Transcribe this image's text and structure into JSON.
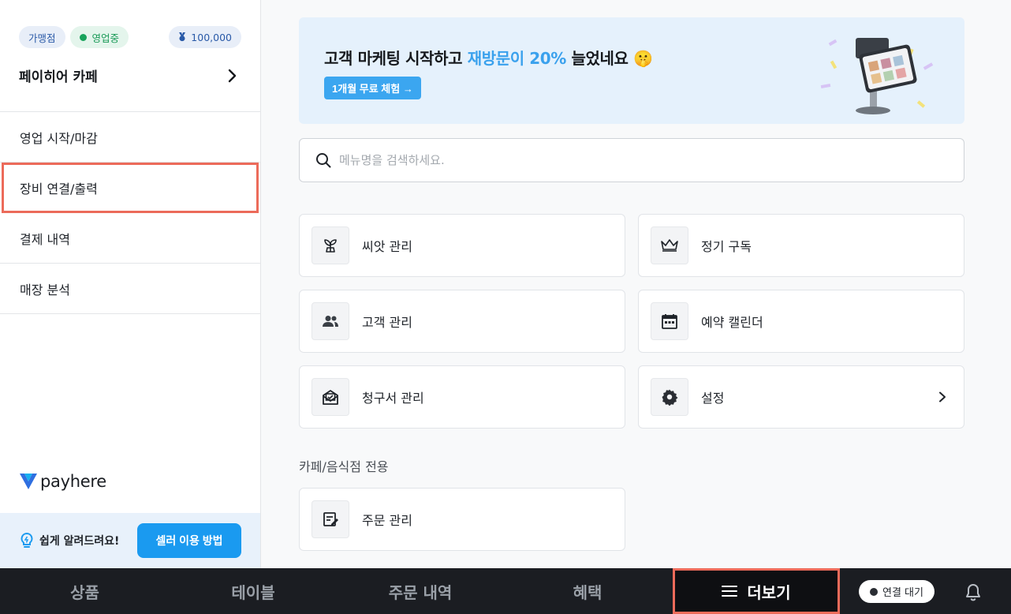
{
  "sidebar": {
    "badges": {
      "franchise": "가맹점",
      "status": "영업중",
      "points": "100,000"
    },
    "store_name": "페이히어 카페",
    "menu": [
      {
        "label": "영업 시작/마감"
      },
      {
        "label": "장비 연결/출력"
      },
      {
        "label": "결제 내역"
      },
      {
        "label": "매장 분석"
      }
    ],
    "logo_text": "payhere",
    "help": {
      "text": "쉽게 알려드려요!",
      "button": "셀러 이용 방법"
    }
  },
  "banner": {
    "title_before": "고객 마케팅 시작하고 ",
    "title_highlight": "재방문이 20%",
    "title_after": " 늘었네요 🤫",
    "button": "1개월 무료 체험 →"
  },
  "search": {
    "placeholder": "메뉴명을 검색하세요."
  },
  "cards": [
    {
      "label": "씨앗 관리",
      "icon": "sprout-icon"
    },
    {
      "label": "정기 구독",
      "icon": "crown-icon"
    },
    {
      "label": "고객 관리",
      "icon": "people-icon"
    },
    {
      "label": "예약 캘린더",
      "icon": "calendar-icon"
    },
    {
      "label": "청구서 관리",
      "icon": "invoice-icon"
    },
    {
      "label": "설정",
      "icon": "gear-icon"
    }
  ],
  "section": {
    "title": "카페/음식점 전용",
    "cards": [
      {
        "label": "주문 관리",
        "icon": "edit-note-icon"
      }
    ]
  },
  "tabbar": {
    "tabs": [
      {
        "label": "상품"
      },
      {
        "label": "테이블"
      },
      {
        "label": "주문 내역"
      },
      {
        "label": "혜택"
      },
      {
        "label": "더보기"
      }
    ],
    "status": "연결 대기"
  },
  "colors": {
    "accent": "#1a9af0",
    "highlight_outline": "#ec6b5a",
    "tabbar_bg": "#1b1d22",
    "banner_bg": "#e5f1fc"
  }
}
